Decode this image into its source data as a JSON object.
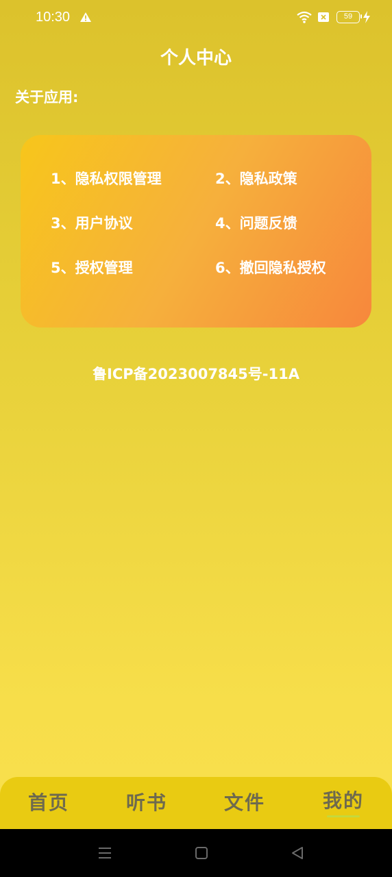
{
  "status_bar": {
    "time": "10:30",
    "battery": "59",
    "icons": [
      "warning-icon",
      "wifi-icon",
      "sim-icon",
      "battery-icon",
      "charging-icon"
    ]
  },
  "header": {
    "title": "个人中心"
  },
  "about": {
    "label": "关于应用:"
  },
  "menu": {
    "items": [
      {
        "label": "1、隐私权限管理"
      },
      {
        "label": "2、隐私政策"
      },
      {
        "label": "3、用户协议"
      },
      {
        "label": "4、问题反馈"
      },
      {
        "label": "5、授权管理"
      },
      {
        "label": "6、撤回隐私授权"
      }
    ]
  },
  "footer": {
    "icp": "鲁ICP备2023007845号-11A"
  },
  "tabs": [
    {
      "label": "首页"
    },
    {
      "label": "听书"
    },
    {
      "label": "文件"
    },
    {
      "label": "我的",
      "active": true
    }
  ],
  "nav_bar": {
    "buttons": [
      "menu-icon",
      "home-icon",
      "back-icon"
    ]
  },
  "colors": {
    "background_top": "#DCC22C",
    "background_bottom": "#F9E04E",
    "card_start": "#F7C61B",
    "card_end": "#F7873C",
    "tab_bar": "#E9CB12",
    "tab_text": "#6E6A4E"
  }
}
